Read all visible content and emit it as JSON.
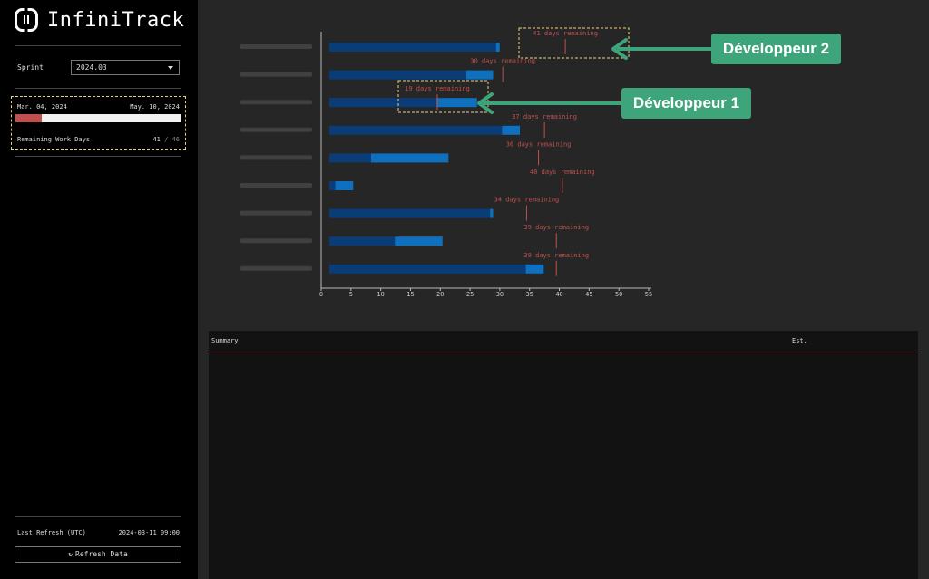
{
  "app": {
    "name": "InfiniTrack"
  },
  "sidebar": {
    "sprint_label": "Sprint",
    "sprint_value": "2024.03",
    "start_date": "Mar. 04, 2024",
    "end_date": "May. 10, 2024",
    "progress_fraction": 0.16,
    "remaining_label": "Remaining Work Days",
    "remaining_value": "41",
    "remaining_sep": "/",
    "remaining_total": "46",
    "last_refresh_label": "Last Refresh (UTC)",
    "last_refresh_value": "2024-03-11 09:00",
    "refresh_button": "Refresh Data",
    "refresh_icon": "refresh-icon"
  },
  "chart_data": {
    "type": "bar",
    "orientation": "horizontal-stacked",
    "categories": [
      "",
      "",
      "",
      "",
      "",
      "",
      "",
      "",
      ""
    ],
    "series": [
      {
        "values": [
          28,
          23,
          18,
          29,
          7,
          1,
          27,
          11,
          33
        ]
      },
      {
        "values": [
          0.6,
          4.5,
          6.8,
          3,
          13,
          3,
          0.5,
          8,
          3
        ]
      }
    ],
    "remaining_markers": [
      {
        "value": 41,
        "label": "41 days remaining"
      },
      {
        "value": 30.5,
        "label": "30 days remaining"
      },
      {
        "value": 19.5,
        "label": "19 days remaining"
      },
      {
        "value": 37.5,
        "label": "37 days remaining"
      },
      {
        "value": 36.5,
        "label": "36 days remaining"
      },
      {
        "value": 40.5,
        "label": "40 days remaining"
      },
      {
        "value": 34.5,
        "label": "34 days remaining"
      },
      {
        "value": 39.5,
        "label": "39 days remaining"
      },
      {
        "value": 39.5,
        "label": "39 days remaining"
      }
    ],
    "xticks": [
      "0",
      "5",
      "10",
      "15",
      "20",
      "25",
      "30",
      "35",
      "40",
      "45",
      "50",
      "55"
    ],
    "xlim": [
      0,
      55
    ],
    "colors": {
      "base": "#0a3d78",
      "extra": "#0f70bf",
      "marker": "#c0504d"
    }
  },
  "table": {
    "col_summary": "Summary",
    "col_est": "Est."
  },
  "annotations": [
    {
      "label": "Développeur 2"
    },
    {
      "label": "Développeur 1"
    }
  ],
  "colors": {
    "accent": "#3ea47a",
    "highlight_border": "#f0d080"
  }
}
